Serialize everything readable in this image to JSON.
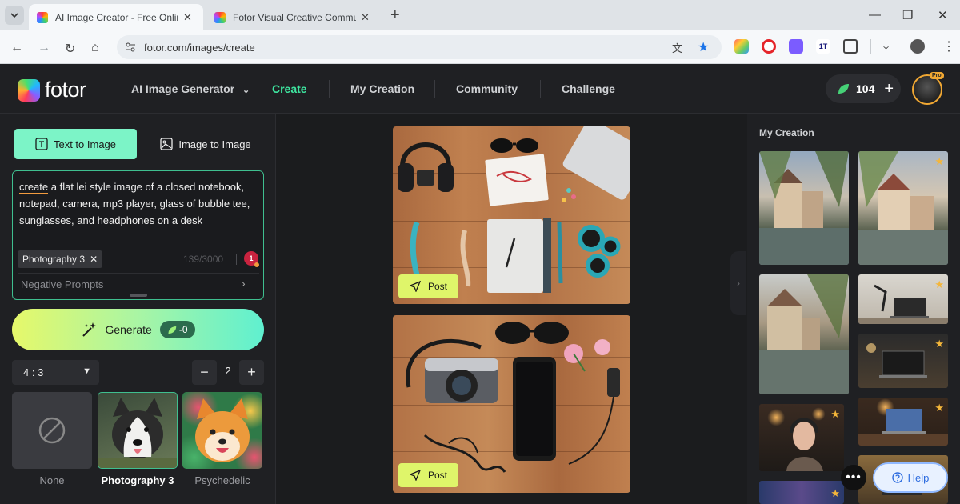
{
  "browser": {
    "tabs": [
      {
        "title": "AI Image Creator - Free Online",
        "active": true
      },
      {
        "title": "Fotor Visual Creative Communi",
        "active": false
      }
    ],
    "url": "fotor.com/images/create"
  },
  "header": {
    "logo": "fotor",
    "nav": [
      {
        "label": "AI Image Generator",
        "active": false
      },
      {
        "label": "Create",
        "active": true
      },
      {
        "label": "My Creation",
        "active": false
      },
      {
        "label": "Community",
        "active": false
      },
      {
        "label": "Challenge",
        "active": false
      }
    ],
    "credits": "104",
    "pro_badge": "Pro"
  },
  "left": {
    "mode_tabs": [
      {
        "label": "Text to Image",
        "active": true
      },
      {
        "label": "Image to Image",
        "active": false
      }
    ],
    "prompt_underlined": "create",
    "prompt_rest": " a flat lei style image of a closed notebook, notepad, camera, mp3 player, glass of bubble tee, sunglasses, and headphones on a desk",
    "style_chip": "Photography 3",
    "char_count": "139/3000",
    "badge": "1",
    "negative_prompts": "Negative Prompts",
    "generate_label": "Generate",
    "generate_cost": "-0",
    "ratio": "4 : 3",
    "quantity": "2",
    "styles": [
      {
        "label": "None",
        "selected": false
      },
      {
        "label": "Photography 3",
        "selected": true
      },
      {
        "label": "Psychedelic",
        "selected": false
      }
    ]
  },
  "center": {
    "post_label": "Post"
  },
  "right": {
    "title": "My Creation"
  },
  "help": "Help",
  "colors": {
    "accent": "#3ee6a0",
    "generate_start": "#e6f86a",
    "generate_end": "#5ff0d0",
    "post": "#dff56a",
    "star": "#f4b63a"
  }
}
